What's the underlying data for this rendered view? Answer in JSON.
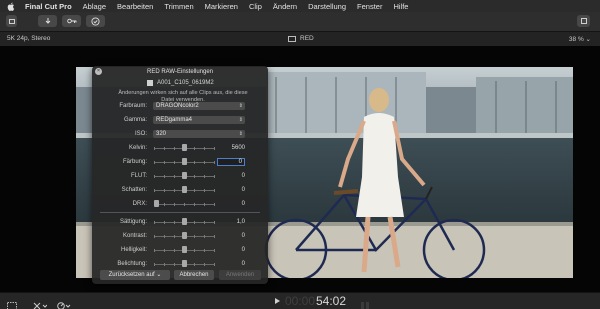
{
  "menubar": {
    "app_name": "Final Cut Pro",
    "items": [
      "Ablage",
      "Bearbeiten",
      "Trimmen",
      "Markieren",
      "Clip",
      "Ändern",
      "Darstellung",
      "Fenster",
      "Hilfe"
    ]
  },
  "toolbar": {
    "buttons": [
      "import-icon",
      "keywords-icon",
      "background-tasks-icon"
    ]
  },
  "viewer_header": {
    "format": "5K 24p, Stereo",
    "title": "RED",
    "zoom": "38 %"
  },
  "hud": {
    "title": "RED RAW-Einstellungen",
    "clip_name": "A001_C105_0619M2",
    "note": "Änderungen wirken sich auf alle Clips aus, die diese Datei verwenden.",
    "farbraum": {
      "label": "Farbraum:",
      "value": "DRAGONcolor2"
    },
    "gamma": {
      "label": "Gamma:",
      "value": "REDgamma4"
    },
    "iso": {
      "label": "ISO:",
      "value": "320"
    },
    "sliders": [
      {
        "label": "Kelvin:",
        "value": "5600",
        "level": 0.5
      },
      {
        "label": "Färbung:",
        "value": "0",
        "level": 0.5,
        "editing": true
      },
      {
        "label": "FLUT:",
        "value": "0",
        "level": 0.5
      },
      {
        "label": "Schatten:",
        "value": "0",
        "level": 0.5
      },
      {
        "label": "DRX:",
        "value": "0",
        "level": 0.0
      },
      {
        "label": "Sättigung:",
        "value": "1,0",
        "level": 0.5
      },
      {
        "label": "Kontrast:",
        "value": "0",
        "level": 0.5
      },
      {
        "label": "Helligkeit:",
        "value": "0",
        "level": 0.5
      },
      {
        "label": "Belichtung:",
        "value": "0",
        "level": 0.5
      }
    ],
    "reset_label": "Zurücksetzen auf",
    "cancel_label": "Abbrechen",
    "apply_label": "Anwenden"
  },
  "playback": {
    "timecode_dim": "00:00",
    "timecode": "54:02"
  },
  "colors": {
    "accent": "#4a7fd0",
    "panel": "#262626",
    "menubar": "#2b2b2b"
  }
}
